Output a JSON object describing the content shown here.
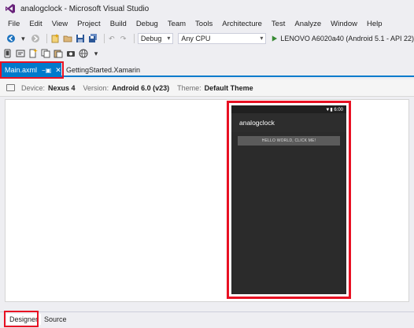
{
  "window": {
    "title": "analogclock - Microsoft Visual Studio",
    "logo_icon": "visual-studio-logo-icon"
  },
  "menu": {
    "items": [
      "File",
      "Edit",
      "View",
      "Project",
      "Build",
      "Debug",
      "Team",
      "Tools",
      "Architecture",
      "Test",
      "Analyze",
      "Window",
      "Help"
    ]
  },
  "toolbar": {
    "configuration": "Debug",
    "platform": "Any CPU",
    "run_target": "LENOVO A6020a40 (Android 5.1 - API 22)"
  },
  "tabs": {
    "main": "Main.axml",
    "main_pin": "−▣",
    "main_close": "✕",
    "getting_started": "GettingStarted.Xamarin"
  },
  "designer_options": {
    "device_label": "Device:",
    "device_value": "Nexus 4",
    "version_label": "Version:",
    "version_value": "Android 6.0 (v23)",
    "theme_label": "Theme:",
    "theme_value": "Default Theme"
  },
  "phone_preview": {
    "status_text": "▼▮ 6:00",
    "app_title": "analogclock",
    "button_text": "HELLO WORLD, CLICK ME!"
  },
  "bottom_tabs": {
    "designer": "Designer",
    "source": "Source"
  },
  "colors": {
    "accent": "#007acc",
    "highlight": "#e81123",
    "run": "#388a34"
  }
}
